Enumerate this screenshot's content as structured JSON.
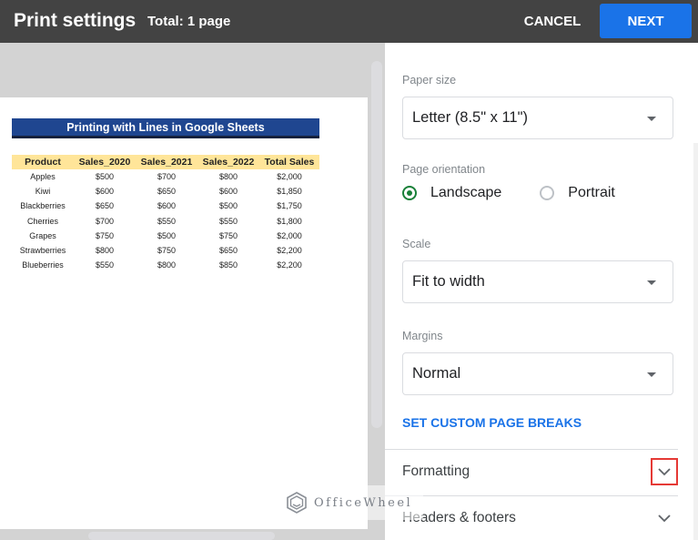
{
  "header": {
    "title": "Print settings",
    "total": "Total: 1 page",
    "cancel_label": "CANCEL",
    "next_label": "NEXT"
  },
  "sheet": {
    "title": "Printing with Lines in Google Sheets",
    "columns": [
      "Product",
      "Sales_2020",
      "Sales_2021",
      "Sales_2022",
      "Total Sales"
    ],
    "rows": [
      [
        "Apples",
        "$500",
        "$700",
        "$800",
        "$2,000"
      ],
      [
        "Kiwi",
        "$600",
        "$650",
        "$600",
        "$1,850"
      ],
      [
        "Blackberries",
        "$650",
        "$600",
        "$500",
        "$1,750"
      ],
      [
        "Cherries",
        "$700",
        "$550",
        "$550",
        "$1,800"
      ],
      [
        "Grapes",
        "$750",
        "$500",
        "$750",
        "$2,000"
      ],
      [
        "Strawberries",
        "$800",
        "$750",
        "$650",
        "$2,200"
      ],
      [
        "Blueberries",
        "$550",
        "$800",
        "$850",
        "$2,200"
      ]
    ],
    "title_color": "#1f4690",
    "header_color": "#ffe599"
  },
  "settings": {
    "paper_size": {
      "label": "Paper size",
      "value": "Letter (8.5\" x 11\")"
    },
    "orientation": {
      "label": "Page orientation",
      "options": [
        "Landscape",
        "Portrait"
      ],
      "selected": "Landscape"
    },
    "scale": {
      "label": "Scale",
      "value": "Fit to width"
    },
    "margins": {
      "label": "Margins",
      "value": "Normal"
    },
    "custom_breaks_label": "SET CUSTOM PAGE BREAKS",
    "sections": [
      {
        "label": "Formatting",
        "highlighted": true
      },
      {
        "label": "Headers & footers",
        "highlighted": false
      }
    ]
  },
  "watermark": {
    "text": "OfficeWheel"
  },
  "colors": {
    "accent": "#1a73e8",
    "radio_selected": "#188038",
    "highlight_box": "#e53935",
    "topbar": "#434343"
  }
}
